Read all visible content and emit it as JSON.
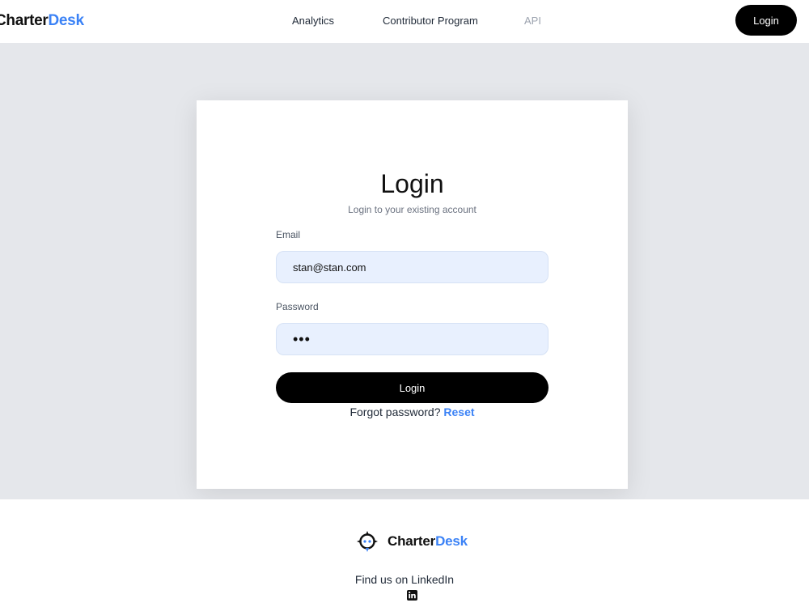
{
  "header": {
    "brand": {
      "part1": "Charter",
      "part2": "Desk"
    },
    "nav": [
      {
        "label": "Analytics"
      },
      {
        "label": "Contributor Program"
      },
      {
        "label": "API"
      }
    ],
    "login_button": "Login"
  },
  "login_card": {
    "title": "Login",
    "subtitle": "Login to your existing account",
    "email_label": "Email",
    "email_value": "stan@stan.com",
    "password_label": "Password",
    "password_value": "•••",
    "submit_label": "Login",
    "forgot_text": "Forgot password?",
    "reset_label": "Reset"
  },
  "footer": {
    "brand": {
      "part1": "Charter",
      "part2": "Desk"
    },
    "logo_icon": "compass-logo-icon",
    "find_text": "Find us on LinkedIn",
    "social_icon": "linkedin-icon"
  },
  "colors": {
    "accent": "#3b82f6",
    "band_background": "#e5e7eb",
    "input_background": "#e8f0fe",
    "button": "#000000"
  }
}
